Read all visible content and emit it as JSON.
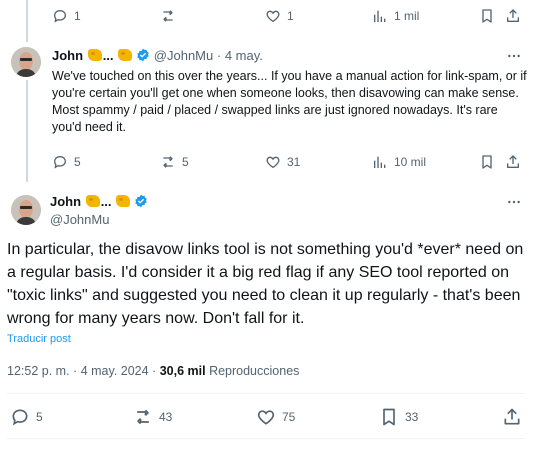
{
  "tweet1": {
    "replies": "1",
    "retweets": "",
    "likes": "1",
    "views": "1 mil"
  },
  "tweet2": {
    "author": "John",
    "ellipsis": "...",
    "handle": "@JohnMu",
    "dot": "·",
    "date": "4 may.",
    "text": "We've touched on this over the years... If you have a manual action for link-spam, or if you're certain you'll get one when someone looks, then disavowing can make sense. Most spammy / paid / placed / swapped links are just ignored nowadays. It's rare you'd need it.",
    "replies": "5",
    "retweets": "5",
    "likes": "31",
    "views": "10 mil"
  },
  "tweet3": {
    "author": "John",
    "ellipsis": "...",
    "handle": "@JohnMu",
    "text": "In particular, the disavow links tool is not something you'd *ever* need on a regular basis. I'd consider it a big red flag if any SEO tool reported on \"toxic links\" and suggested you need to clean it up regularly - that's been wrong for many years now. Don't fall for it.",
    "translate": "Traducir post",
    "time": "12:52 p. m.",
    "sep": "·",
    "date": "4 may. 2024",
    "sep2": "·",
    "views_count": "30,6 mil",
    "views_label": "Reproducciones",
    "replies": "5",
    "retweets": "43",
    "likes": "75",
    "bookmarks": "33"
  },
  "colors": {
    "text": "#0f1419",
    "muted": "#536471",
    "link": "#1d9bf0",
    "verified": "#1d9bf0"
  },
  "icons": [
    "reply-icon",
    "retweet-icon",
    "like-icon",
    "views-icon",
    "bookmark-icon",
    "share-icon",
    "more-icon",
    "verified-icon"
  ]
}
